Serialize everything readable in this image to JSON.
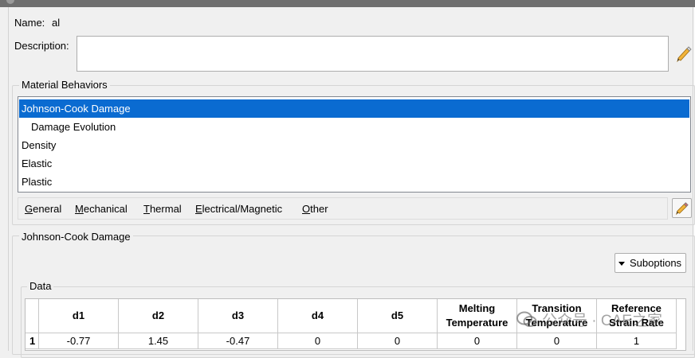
{
  "material": {
    "name_label": "Name:",
    "name_value": "al",
    "description_label": "Description:",
    "description_value": ""
  },
  "behaviors": {
    "group_title": "Material Behaviors",
    "items": [
      {
        "label": "Johnson-Cook Damage",
        "selected": true
      },
      {
        "label": "Damage Evolution",
        "selected": false
      },
      {
        "label": "Density",
        "selected": false
      },
      {
        "label": "Elastic",
        "selected": false
      },
      {
        "label": "Plastic",
        "selected": false
      }
    ]
  },
  "menu": {
    "general": {
      "u": "G",
      "rest": "eneral"
    },
    "mechanical": {
      "u": "M",
      "rest": "echanical"
    },
    "thermal": {
      "u": "T",
      "rest": "hermal"
    },
    "electrical": {
      "u": "E",
      "rest": "lectrical/Magnetic"
    },
    "other": {
      "u": "O",
      "rest": "ther"
    }
  },
  "editor": {
    "section_title": "Johnson-Cook Damage",
    "suboptions_label": "Suboptions",
    "data_group_title": "Data"
  },
  "table": {
    "headers": [
      "d1",
      "d2",
      "d3",
      "d4",
      "d5",
      "Melting\nTemperature",
      "Transition\nTemperature",
      "Reference\nStrain Rate"
    ],
    "rows": [
      {
        "index": "1",
        "cells": [
          "-0.77",
          "1.45",
          "-0.47",
          "0",
          "0",
          "0",
          "0",
          "1"
        ]
      }
    ]
  },
  "watermark": {
    "text": "公众号 · CAE之家"
  },
  "colors": {
    "selection": "#0a6bd1",
    "background": "#f0f0f0"
  },
  "icons": {
    "edit_description": "pencil-icon",
    "edit_behavior": "pencil-icon",
    "dropdown": "triangle-down-icon"
  }
}
